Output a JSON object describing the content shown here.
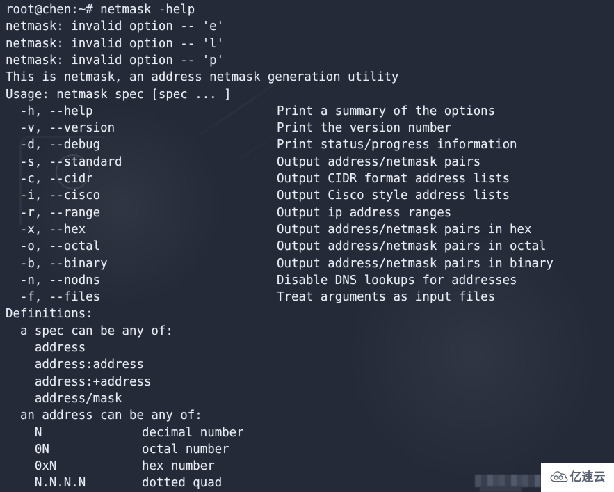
{
  "terminal": {
    "prompt_line": "root@chen:~# netmask -help",
    "background_color": "#242a38",
    "text_color": "#e9edf2",
    "error_lines": [
      "netmask: invalid option -- 'e'",
      "netmask: invalid option -- 'l'",
      "netmask: invalid option -- 'p'"
    ],
    "intro_line": "This is netmask, an address netmask generation utility",
    "usage_line": "Usage: netmask spec [spec ... ]",
    "options": [
      {
        "flags": "  -h, --help",
        "description": "Print a summary of the options"
      },
      {
        "flags": "  -v, --version",
        "description": "Print the version number"
      },
      {
        "flags": "  -d, --debug",
        "description": "Print status/progress information"
      },
      {
        "flags": "  -s, --standard",
        "description": "Output address/netmask pairs"
      },
      {
        "flags": "  -c, --cidr",
        "description": "Output CIDR format address lists"
      },
      {
        "flags": "  -i, --cisco",
        "description": "Output Cisco style address lists"
      },
      {
        "flags": "  -r, --range",
        "description": "Output ip address ranges"
      },
      {
        "flags": "  -x, --hex",
        "description": "Output address/netmask pairs in hex"
      },
      {
        "flags": "  -o, --octal",
        "description": "Output address/netmask pairs in octal"
      },
      {
        "flags": "  -b, --binary",
        "description": "Output address/netmask pairs in binary"
      },
      {
        "flags": "  -n, --nodns",
        "description": "Disable DNS lookups for addresses"
      },
      {
        "flags": "  -f, --files",
        "description": "Treat arguments as input files"
      }
    ],
    "definitions_header": "Definitions:",
    "spec_header": "  a spec can be any of:",
    "spec_items": [
      "    address",
      "    address:address",
      "    address:+address",
      "    address/mask"
    ],
    "address_header": "  an address can be any of:",
    "address_items": [
      {
        "key": "    N",
        "description": "decimal number"
      },
      {
        "key": "    0N",
        "description": "octal number"
      },
      {
        "key": "    0xN",
        "description": "hex number"
      },
      {
        "key": "    N.N.N.N",
        "description": "dotted quad"
      }
    ]
  },
  "watermark": {
    "brand_text": "亿速云",
    "icon": "cloud-icon",
    "background_color": "#ffffff",
    "text_color": "#5a6173"
  }
}
